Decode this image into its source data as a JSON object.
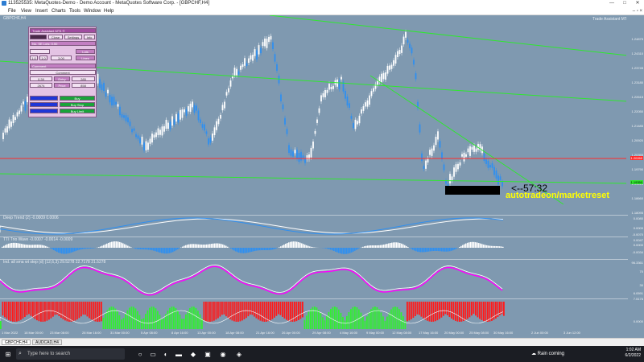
{
  "window": {
    "title": "113525535: MetaQuotes-Demo - Demo Account - MetaQuotes Software Corp. - [GBPCHF,H4]",
    "controls": [
      "—",
      "□",
      "✕"
    ]
  },
  "menu": [
    "File",
    "View",
    "Insert",
    "Charts",
    "Tools",
    "Window",
    "Help"
  ],
  "chart": {
    "symbol_label": "GBPCHF,H4",
    "indicator_label": "Trade Assistant MT4 ©",
    "overlay_timer": "<--57:32",
    "overlay_brand": "autotradeon/marketreset",
    "colors": {
      "background": "#7f99b0",
      "bull": "#ffffff",
      "bear": "#2f8ff0",
      "trendline": "#2ee82e",
      "hline": "#ff2a2a",
      "brand": "#ffff00"
    },
    "price_ticks": [
      "1.24875",
      "1.24310",
      "1.23745",
      "1.23180",
      "1.22615",
      "1.22050",
      "1.21485",
      "1.20920",
      "1.20355",
      "1.19790",
      "1.19225",
      "1.18660",
      "1.18095"
    ],
    "price_marker_red": "1.20260",
    "price_marker_green": "1.19350",
    "time_ticks": [
      "1 Mar 2022",
      "18 Mar 00:00",
      "23 Mar 08:00",
      "28 Mar 16:00",
      "31 Mar 00:00",
      "5 Apr 08:00",
      "8 Apr 16:00",
      "13 Apr 00:00",
      "18 Apr 08:00",
      "21 Apr 16:00",
      "26 Apr 00:00",
      "29 Apr 08:00",
      "4 May 16:00",
      "9 May 00:00",
      "12 May 08:00",
      "17 May 16:00",
      "20 May 00:00",
      "25 May 08:00",
      "30 May 16:00",
      "2 Jun 00:00",
      "3 Jun 12:00"
    ],
    "panels": [
      {
        "label": "Deep Trend (2) -0.0009 0.0006",
        "ticks": [
          "0.0080",
          "0.0000",
          "-0.0070"
        ]
      },
      {
        "label": "TTI Trio Wave -0.0007 -0.0014 -0.0009",
        "ticks": [
          "0.0047",
          "0.0000",
          "-0.0034"
        ]
      },
      {
        "label": "Ind. all sma wt step (d) (12,6,3) 29.5278 22.7178 21.5278",
        "ticks": [
          "96.3361",
          "70",
          "30",
          "6.0591"
        ]
      },
      {
        "label": "",
        "ticks": [
          "7.5176",
          "0.0000"
        ]
      }
    ]
  },
  "trade_assistant": {
    "header": "Trade Assistant MT4 ©",
    "buttons_row1": [
      "Close",
      "Settings",
      "Info"
    ],
    "row_lot_label": "No. SE Lots: 0.50",
    "lots_label": "Lots",
    "fields_sl_tp": [
      "1.0",
      "1.0",
      "3.00"
    ],
    "tp_label": "Lines",
    "comment_label": "Comment",
    "comment_value": "Comment",
    "entry_label": "Entry",
    "entry_value": "285",
    "sl_value": "0.39",
    "price_left": "2674",
    "price_label": "Price",
    "price_right": "858",
    "buy_label": "Buy",
    "buy_stop_label": "Buy Stop",
    "buy_limit_label": "Buy Limit"
  },
  "tabs": [
    "GBPCHF,H4",
    "AUDCAD,H4"
  ],
  "taskbar": {
    "search_placeholder": "Type here to search",
    "weather": "Rain coming",
    "time": "1:02 AM",
    "date": "6/2/2022"
  }
}
